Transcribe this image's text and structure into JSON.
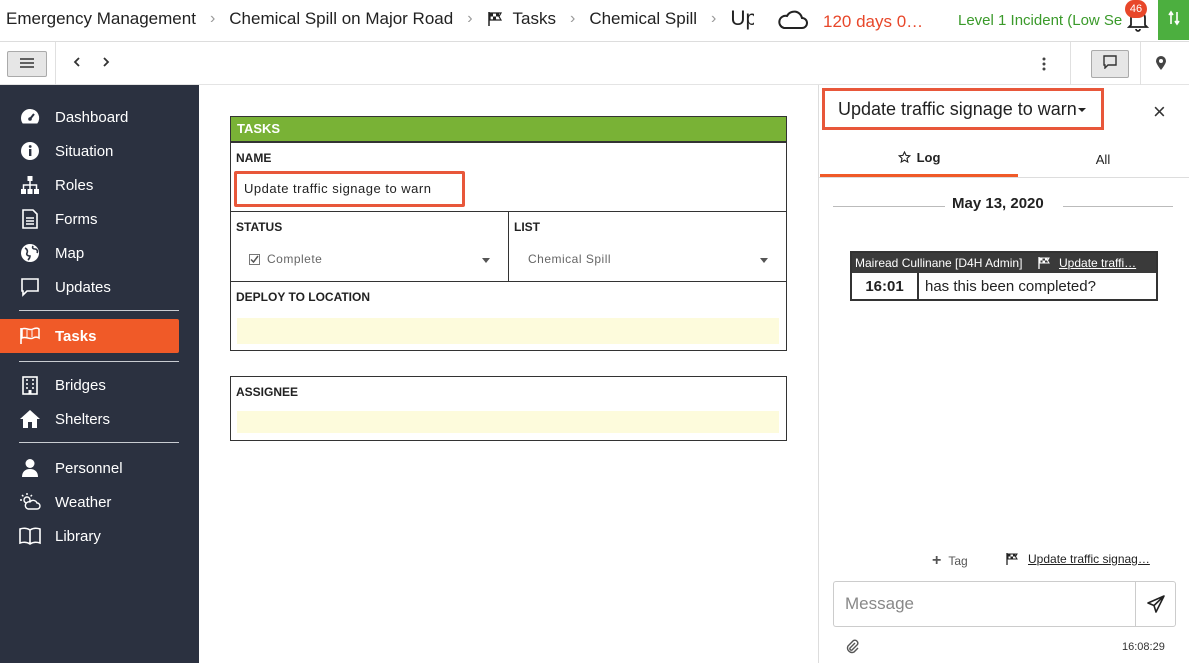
{
  "topbar": {
    "breadcrumbs": [
      "Emergency Management",
      "Chemical Spill on Major Road",
      "Tasks",
      "Chemical Spill",
      "Update traffic signage to warn"
    ],
    "days_label": "120 days 0…",
    "level_label": "Level 1 Incident (Low Se",
    "notification_count": "46"
  },
  "sidebar": {
    "items": [
      {
        "label": "Dashboard",
        "icon": "dashboard-icon"
      },
      {
        "label": "Situation",
        "icon": "info-icon"
      },
      {
        "label": "Roles",
        "icon": "org-chart-icon"
      },
      {
        "label": "Forms",
        "icon": "form-icon"
      },
      {
        "label": "Map",
        "icon": "globe-icon"
      },
      {
        "label": "Updates",
        "icon": "chat-icon"
      },
      {
        "label": "Tasks",
        "icon": "flag-icon"
      },
      {
        "label": "Bridges",
        "icon": "building-icon"
      },
      {
        "label": "Shelters",
        "icon": "house-icon"
      },
      {
        "label": "Personnel",
        "icon": "person-icon"
      },
      {
        "label": "Weather",
        "icon": "sun-cloud-icon"
      },
      {
        "label": "Library",
        "icon": "book-icon"
      }
    ]
  },
  "form": {
    "header": "TASKS",
    "name_label": "NAME",
    "name_value": "Update traffic signage to warn",
    "status_label": "STATUS",
    "status_value": "Complete",
    "list_label": "LIST",
    "list_value": "Chemical Spill",
    "deploy_label": "DEPLOY TO LOCATION",
    "deploy_value": "",
    "assignee_label": "ASSIGNEE",
    "assignee_value": ""
  },
  "panel": {
    "title": "Update traffic signage to warn",
    "tabs": [
      {
        "label": "Log"
      },
      {
        "label": "All"
      }
    ],
    "date": "May 13, 2020",
    "message": {
      "author": "Mairead Cullinane [D4H Admin]",
      "task_link": "Update traffi…",
      "time": "16:01",
      "text": "has this been completed?"
    },
    "tag_label": "Tag",
    "task_link": "Update traffic signag…",
    "message_placeholder": "Message",
    "clock": "16:08:29"
  },
  "colors": {
    "accent": "#f05a28",
    "highlight_border": "#e8573a",
    "sidebar_bg": "#2b3140",
    "tasks_header": "#79b236",
    "level_text": "#3a9a2a",
    "days_text": "#e8472a",
    "field_yellow": "#fdfbdc"
  }
}
